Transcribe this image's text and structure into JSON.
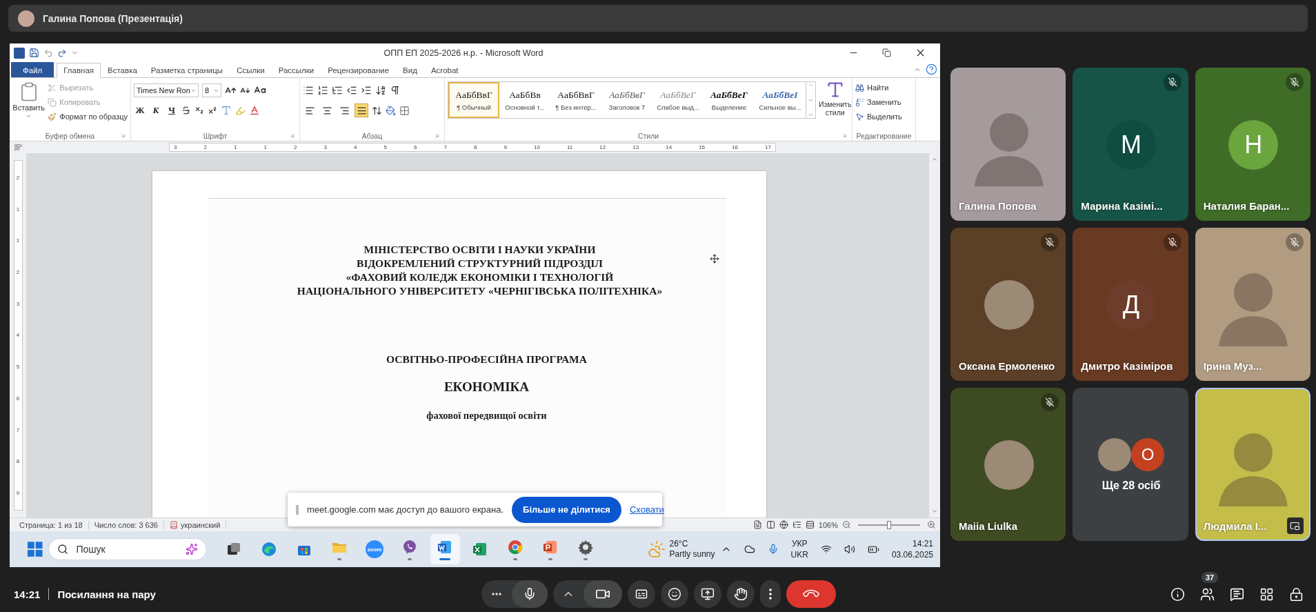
{
  "presenter_bar": {
    "title": "Галина Попова (Презентація)"
  },
  "word": {
    "title": "ОПП ЕП 2025-2026 н.р. - Microsoft Word",
    "tabs": [
      {
        "label": "Файл",
        "kind": "file",
        "selected": false
      },
      {
        "label": "Главная",
        "kind": "tab",
        "selected": true
      },
      {
        "label": "Вставка",
        "kind": "tab",
        "selected": false
      },
      {
        "label": "Разметка страницы",
        "kind": "tab",
        "selected": false
      },
      {
        "label": "Ссылки",
        "kind": "tab",
        "selected": false
      },
      {
        "label": "Рассылки",
        "kind": "tab",
        "selected": false
      },
      {
        "label": "Рецензирование",
        "kind": "tab",
        "selected": false
      },
      {
        "label": "Вид",
        "kind": "tab",
        "selected": false
      },
      {
        "label": "Acrobat",
        "kind": "tab",
        "selected": false
      }
    ],
    "clipboard": {
      "paste": "Вставить",
      "group": "Буфер обмена",
      "items": [
        {
          "label": "Вырезать",
          "kind": "cut",
          "disabled": true
        },
        {
          "label": "Копировать",
          "kind": "copy",
          "disabled": true
        },
        {
          "label": "Формат по образцу",
          "kind": "painter",
          "disabled": false
        }
      ]
    },
    "font": {
      "name": "Times New Ron",
      "size": "8",
      "format_buttons": [
        "Ж",
        "К",
        "Ч"
      ],
      "group": "Шрифт"
    },
    "paragraph": {
      "group": "Абзац",
      "alignments": [
        {
          "kind": "left",
          "selected": false
        },
        {
          "kind": "center",
          "selected": false
        },
        {
          "kind": "right",
          "selected": false
        },
        {
          "kind": "justify",
          "selected": true
        }
      ]
    },
    "styles": {
      "group": "Стили",
      "change": "Изменить стили",
      "items": [
        {
          "sample": "АаБбВвГ",
          "label": "¶ Обычный",
          "kind": "normal",
          "selected": true
        },
        {
          "sample": "АаБбВв",
          "label": "Основной т...",
          "kind": "normal",
          "selected": false
        },
        {
          "sample": "АаБбВвГ",
          "label": "¶ Без интер...",
          "kind": "normal",
          "selected": false
        },
        {
          "sample": "АаБбВвГ",
          "label": "Заголовок 7",
          "kind": "heading",
          "selected": false
        },
        {
          "sample": "АаБбВеГ",
          "label": "Слабое выд...",
          "kind": "subtle",
          "selected": false
        },
        {
          "sample": "АаБбВеГ",
          "label": "Выделение",
          "kind": "emphasis",
          "selected": false
        },
        {
          "sample": "АаБбВеІ",
          "label": "Сильное вы...",
          "kind": "intense",
          "selected": false
        }
      ]
    },
    "editing": {
      "group": "Редактирование",
      "items": [
        {
          "label": "Найти",
          "kind": "find"
        },
        {
          "label": "Заменить",
          "kind": "replace"
        },
        {
          "label": "Выделить",
          "kind": "select"
        }
      ]
    },
    "ruler": {
      "labels": [
        "3",
        "2",
        "1",
        "1",
        "2",
        "3",
        "4",
        "5",
        "6",
        "7",
        "8",
        "9",
        "10",
        "11",
        "12",
        "13",
        "14",
        "15",
        "16",
        "17"
      ]
    },
    "vertical_ruler": {
      "labels": [
        "2",
        "1",
        "1",
        "2",
        "3",
        "4",
        "5",
        "6",
        "7",
        "8",
        "9"
      ]
    },
    "document": {
      "header_lines": [
        "МІНІСТЕРСТВО ОСВІТИ І НАУКИ УКРАЇНИ",
        "ВІДОКРЕМЛЕНИЙ СТРУКТУРНИЙ ПІДРОЗДІЛ",
        "«ФАХОВИЙ КОЛЕДЖ ЕКОНОМІКИ І ТЕХНОЛОГІЙ",
        "НАЦІОНАЛЬНОГО УНІВЕРСИТЕТУ «ЧЕРНІГІВСЬКА ПОЛІТЕХНІКА»"
      ],
      "program": "ОСВІТНЬО-ПРОФЕСІЙНА ПРОГРАМА",
      "title": "ЕКОНОМІКА",
      "subtitle": "фахової передвищої освіти"
    },
    "status_bar": {
      "items": [
        "Страница: 1 из 18",
        "Число слов: 3 636",
        "украинский"
      ],
      "zoom": {
        "reading": "106%",
        "level": 0.5
      }
    }
  },
  "share_banner": {
    "text": "meet.google.com має доступ до вашого екрана.",
    "stop": "Більше не ділитися",
    "hide": "Сховати"
  },
  "taskbar": {
    "search": {
      "placeholder": "Пошук"
    },
    "apps": [
      {
        "kind": "taskview",
        "selected": false,
        "running": false
      },
      {
        "kind": "edge",
        "selected": false,
        "running": false
      },
      {
        "kind": "store",
        "selected": false,
        "running": false
      },
      {
        "kind": "folder",
        "selected": false,
        "running": true
      },
      {
        "kind": "zoom",
        "label": "zoom",
        "selected": false,
        "running": false
      },
      {
        "kind": "viber",
        "selected": false,
        "running": true
      },
      {
        "kind": "word",
        "selected": true,
        "running": true
      },
      {
        "kind": "excel",
        "selected": false,
        "running": false
      },
      {
        "kind": "chrome",
        "selected": false,
        "running": true
      },
      {
        "kind": "powerpoint",
        "selected": false,
        "running": true
      },
      {
        "kind": "settings",
        "selected": false,
        "running": true
      }
    ],
    "weather": {
      "temp": "26°C",
      "desc": "Partly sunny"
    },
    "language": [
      "УКР",
      "UKR"
    ],
    "time": "14:21",
    "date": "03.06.2025"
  },
  "participants": {
    "rows": [
      {
        "tiles": [
          {
            "name": "Галина Попова",
            "kind": "video",
            "color": "#a59b9c",
            "muted": false,
            "speaking": false,
            "self_view": false
          },
          {
            "name": "Марина Казімі...",
            "kind": "letter",
            "avatar": {
              "letter": "М",
              "color": "#0f4d42"
            },
            "color": "#155446",
            "muted": true,
            "speaking": false,
            "self_view": false
          },
          {
            "name": "Наталия Баран...",
            "kind": "letter",
            "avatar": {
              "letter": "Н",
              "color": "#6aa53d"
            },
            "color": "#3f6c27",
            "muted": true,
            "speaking": false,
            "self_view": false
          }
        ]
      },
      {
        "tiles": [
          {
            "name": "Оксана Ермоленко",
            "kind": "photo",
            "color": "#5b3f26",
            "muted": true,
            "speaking": false,
            "self_view": false
          },
          {
            "name": "Дмитро Казіміров",
            "kind": "letter",
            "avatar": {
              "letter": "Д",
              "color": "#6d3c2a"
            },
            "color": "#693a22",
            "muted": true,
            "speaking": false,
            "self_view": false
          },
          {
            "name": "Ірина Муз...",
            "kind": "video",
            "color": "#b19c82",
            "muted": true,
            "speaking": false,
            "self_view": false
          }
        ]
      },
      {
        "tiles": [
          {
            "name": "Maiia Liulka",
            "kind": "photo",
            "color": "#3d4a22",
            "muted": true,
            "speaking": false,
            "self_view": false
          },
          {
            "name": "Ще 28 осіб",
            "kind": "more",
            "avatar": {
              "letter": "О",
              "color": "#c3411f"
            },
            "color": "#3c4043",
            "muted": false,
            "speaking": false,
            "self_view": false
          },
          {
            "name": "Людмила І...",
            "kind": "video",
            "color": "#c4bd4a",
            "muted": false,
            "speaking": true,
            "self_view": true
          }
        ]
      }
    ]
  },
  "bottom_bar": {
    "time": "14:21",
    "meeting": "Посилання на пару",
    "mic_on": true,
    "camera_on": true,
    "people_count": "37"
  }
}
